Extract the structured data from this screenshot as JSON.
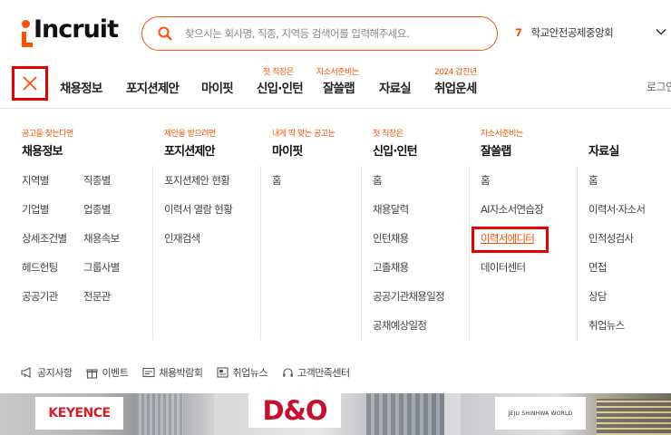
{
  "brand": {
    "logo_text": "Incruit",
    "accent": "#ff5000",
    "highlight": "#e60000"
  },
  "search": {
    "placeholder": "찾으시는 회사명, 직종, 지역등 검색어를 입력해주세요.",
    "value": ""
  },
  "ranking": {
    "number": "7",
    "keyword": "학교안전공제중앙회"
  },
  "nav": {
    "items": [
      {
        "label": "채용정보",
        "badge": ""
      },
      {
        "label": "포지션제안",
        "badge": ""
      },
      {
        "label": "마이핏",
        "badge": ""
      },
      {
        "label": "신입·인턴",
        "badge": "첫 직장은"
      },
      {
        "label": "잘쓸랩",
        "badge": "자소서준비는"
      },
      {
        "label": "자료실",
        "badge": ""
      },
      {
        "label": "취업운세",
        "badge": "2024 갑진년"
      }
    ],
    "login": "로그인"
  },
  "menu": {
    "columns": [
      {
        "subtitle": "공고들 찾는다면",
        "title": "채용정보",
        "links": [
          "지역별",
          "직종별",
          "기업별",
          "업종별",
          "상세조건별",
          "채용속보",
          "헤드헌팅",
          "그룹사별",
          "공공기관",
          "전문관"
        ]
      },
      {
        "subtitle": "제안을 받으려면",
        "title": "포지션제안",
        "links": [
          "포지션제안 현황",
          "이력서 열람 현황",
          "인재검색"
        ]
      },
      {
        "subtitle": "내게 딱 맞는 공고는",
        "title": "마이핏",
        "links": [
          "홈"
        ]
      },
      {
        "subtitle": "첫 직장은",
        "title": "신입·인턴",
        "links": [
          "홈",
          "채용달력",
          "인턴채용",
          "고졸채용",
          "공공기관채용일정",
          "공채예상일정"
        ]
      },
      {
        "subtitle": "자소서준비는",
        "title": "잘쓸랩",
        "links": [
          "홈",
          "AI자소서연습장",
          "이력서에디터",
          "데이터센터"
        ]
      },
      {
        "subtitle": "",
        "title": "자료실",
        "links": [
          "홈",
          "이력서·자소서",
          "인적성검사",
          "면접",
          "상담",
          "취업뉴스"
        ]
      }
    ]
  },
  "bottom_links": [
    "공지사항",
    "이벤트",
    "채용박람회",
    "취업뉴스",
    "고객만족센터"
  ],
  "banners": [
    {
      "logo": "KEYENCE"
    },
    {
      "logo": "D&O"
    },
    {
      "logo": "JEJU SHINHWA WORLD"
    }
  ]
}
